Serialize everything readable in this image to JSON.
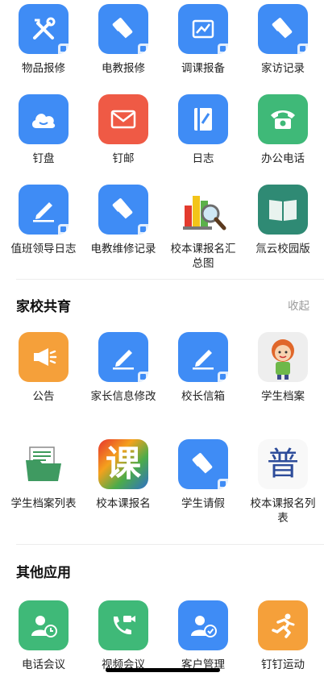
{
  "colors": {
    "blue": "#3f8cf5",
    "red": "#ef5a45",
    "green": "#3fb978",
    "teal": "#2f8a74",
    "orange": "#f5a03a",
    "action_gray": "#9a9a9a"
  },
  "top_apps": [
    {
      "label": "物品报修",
      "icon": "tools-icon"
    },
    {
      "label": "电教报修",
      "icon": "broom-icon"
    },
    {
      "label": "调课报备",
      "icon": "chart-icon"
    },
    {
      "label": "家访记录",
      "icon": "broom-icon"
    },
    {
      "label": "钉盘",
      "icon": "cloud-icon"
    },
    {
      "label": "钉邮",
      "icon": "mail-icon"
    },
    {
      "label": "日志",
      "icon": "notebook-icon"
    },
    {
      "label": "办公电话",
      "icon": "phone-icon"
    },
    {
      "label": "值班领导日志",
      "icon": "pen-icon"
    },
    {
      "label": "电教维修记录",
      "icon": "broom-icon"
    },
    {
      "label": "校本课报名汇总图",
      "icon": "chart-magnifier-icon"
    },
    {
      "label": "氚云校园版",
      "icon": "book-icon"
    }
  ],
  "family_section": {
    "title": "家校共育",
    "action": "收起",
    "apps": [
      {
        "label": "公告",
        "icon": "megaphone-icon"
      },
      {
        "label": "家长信息修改",
        "icon": "pen-icon"
      },
      {
        "label": "校长信箱",
        "icon": "pen-icon"
      },
      {
        "label": "学生档案",
        "icon": "student-avatar-icon"
      },
      {
        "label": "学生档案列表",
        "icon": "folder-icon"
      },
      {
        "label": "校本课报名",
        "icon": "course-char-icon"
      },
      {
        "label": "学生请假",
        "icon": "broom-icon"
      },
      {
        "label": "校本课报名列表",
        "icon": "pu-char-icon"
      }
    ],
    "course_char": "课",
    "pu_char": "普"
  },
  "other_section": {
    "title": "其他应用",
    "apps": [
      {
        "label": "电话会议",
        "icon": "conference-call-icon"
      },
      {
        "label": "视频会议",
        "icon": "video-call-icon"
      },
      {
        "label": "客户管理",
        "icon": "customer-icon"
      },
      {
        "label": "钉钉运动",
        "icon": "running-icon"
      }
    ]
  }
}
